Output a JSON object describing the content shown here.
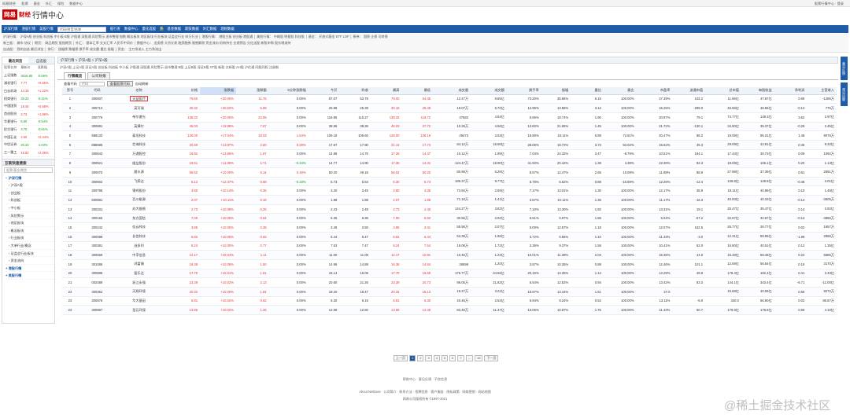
{
  "topbar": [
    "网易财经",
    "股票",
    "基金",
    "外汇",
    "保险",
    "数据中心"
  ],
  "topbar_right": "股票行情中心 · 登录",
  "logo": {
    "brand": "网易",
    "channel": "财经",
    "title": "行情中心"
  },
  "nav": {
    "items": [
      "沪深行情",
      "港股行情",
      "美股行情"
    ],
    "search_placeholder": "代码/拼音/名称",
    "buttons": [
      "股行查",
      "数据中心",
      "量化选股"
    ],
    "tag": "热",
    "extra": [
      "基金数据",
      "期货数据",
      "外汇数据",
      "理财数据"
    ]
  },
  "menu2": [
    "沪深行情：  沪深A股  创业板  科创板  中小板  B股  沪股通  深股通  风险警示  退市整理  指数  概念板块  地区板块  行业板块  证监会行业  申万行业  │  港股行情：  港股主板  创业板  港股通  │  美股行情：  中概股  明星股  科技股  │  基金：  开放式基金  ETF  LOF  │  债券：  国债  企债  可转债",
    "新三板：  做市  协议  │  期货：  商品期货  股指期货  │  外汇：  基本汇率  交叉汇率  人民币中间价  │  数据中心：  龙虎榜  大宗交易  融资融券  限售解禁  资金流向  机构持仓  业绩预告  分红送配  新股申购  股东增减持",
    "自选股：  我的自选  最近浏览  │  排行：  涨幅榜  跌幅榜  换手率  成交额  量比  振幅  │  资金：  主力净流入  主力净流出"
  ],
  "left": {
    "tabs": [
      "最近浏览",
      "自选股"
    ],
    "headers": [
      "股票名称",
      "最新价",
      "涨跌幅"
    ],
    "rows": [
      {
        "name": "上证指数",
        "price": "3016.85",
        "chg": "-0.56%"
      },
      {
        "name": "浦发银行",
        "price": "7.77",
        "chg": "+0.65%"
      },
      {
        "name": "白云机场",
        "price": "14.15",
        "chg": "+1.22%"
      },
      {
        "name": "招商银行",
        "price": "33.23",
        "chg": "-0.21%"
      },
      {
        "name": "中国国贸",
        "price": "18.45",
        "chg": "+0.68%"
      },
      {
        "name": "首创股份",
        "price": "2.73",
        "chg": "+1.86%"
      },
      {
        "name": "华夏银行",
        "price": "5.50",
        "chg": "-0.54%"
      },
      {
        "name": "民生银行",
        "price": "3.70",
        "chg": "-0.81%"
      },
      {
        "name": "中国石化",
        "price": "4.60",
        "chg": "+0.44%"
      },
      {
        "name": "中信证券",
        "price": "20.23",
        "chg": "-1.03%"
      },
      {
        "name": "三一重工",
        "price": "15.82",
        "chg": "+2.06%"
      }
    ],
    "section": "互联快速搜索",
    "search_placeholder": "股票/基金/期货",
    "tree": [
      "沪深行情",
      "沪深A股",
      "创业板",
      "科创板",
      "中小板",
      "风险警示",
      "地区板块",
      "概念板块",
      "行业板块",
      "大单行业/概念",
      "证监会行业板块",
      "资金流向"
    ],
    "tree_foot": [
      "港股行情",
      "美股行情"
    ]
  },
  "main": {
    "breadcrumb": "沪深行情  >  沪深A股  >  沪深A股",
    "subnav": "沪深A股  上证A股  深证A股  创业板  科创板  中小板  沪股通  深股通  风险警示  退市整理  B股  上证B股  深证B股  ST股  新股  次新股  AH股  沪伦通  同股同权  注册制",
    "tabs": [
      "行情概览",
      "公司财报"
    ],
    "filter": {
      "label": "查看代码",
      "placeholder": "代码",
      "button": "查看股票代码",
      "link": "自动刷新"
    },
    "headers": [
      "序号",
      "代码",
      "名称",
      "价格",
      "涨跌幅",
      "涨跌额",
      "5分钟涨跌幅",
      "今开",
      "昨收",
      "最高",
      "最低",
      "成交量",
      "成交额",
      "换手率",
      "振幅",
      "量比",
      "委比",
      "市盈率",
      "流通市值",
      "总市值",
      "每股收益",
      "净利润",
      "主营收入"
    ],
    "rows": [
      [
        "1",
        "300937",
        "天益医疗",
        "79.60",
        "+20.00%",
        "11.76",
        "0.00%",
        "57.07",
        "53.79",
        "79.00",
        "64.45",
        "12.47万",
        "9.85亿",
        "73.20%",
        "35.86%",
        "6.15",
        "100.00%",
        "27.39%",
        "102.2",
        "11.96亿",
        "47.87亿",
        "0.69",
        "-1286万"
      ],
      [
        "2",
        "300713",
        "英可瑞",
        "30.32",
        "+20.02%",
        "5.08",
        "0.00%",
        "25.88",
        "25.39",
        "30.16",
        "25.49",
        "19.07万",
        "5.70亿",
        "12.95%",
        "13.58%",
        "3.12",
        "100.00%",
        "15.25%",
        "-299.0",
        "46.56亿",
        "46.56亿",
        "-0.13",
        "775万"
      ],
      [
        "3",
        "300776",
        "帝尔激光",
        "138.32",
        "+20.00%",
        "23.05",
        "0.00%",
        "116.95",
        "115.27",
        "138.32",
        "116.72",
        "37582",
        "4.84亿",
        "6.65%",
        "18.74%",
        "1.90",
        "100.00%",
        "20.97%",
        "79.1",
        "74.77亿",
        "149.3亿",
        "3.62",
        "2.97亿"
      ],
      [
        "4",
        "300681",
        "英搏尔",
        "46.03",
        "+19.99%",
        "7.67",
        "0.00%",
        "38.96",
        "38.36",
        "46.03",
        "37.72",
        "10.26万",
        "4.56亿",
        "13.60%",
        "21.65%",
        "1.45",
        "100.00%",
        "21.72%",
        "-130.1",
        "34.90亿",
        "35.37亿",
        "-0.26",
        "2.45亿"
      ],
      [
        "5",
        "688133",
        "泰坦科技",
        "128.00",
        "+17.04%",
        "18.03",
        "1.84%",
        "109.18",
        "109.60",
        "128.00",
        "108.19",
        "29473",
        "3.53亿",
        "18.90%",
        "18.11%",
        "5.89",
        "72.81%",
        "20.47%",
        "86.2",
        "19.09亿",
        "95.31亿",
        "1.48",
        "9076万"
      ],
      [
        "6",
        "688595",
        "芯海科技",
        "20.40",
        "+13.97%",
        "2.60",
        "0.28%",
        "17.67",
        "17.90",
        "21.12",
        "17.73",
        "84.12万",
        "16.66亿",
        "28.06%",
        "19.72%",
        "3.73",
        "92.02%",
        "15.52%",
        "45.3",
        "29.09亿",
        "42.81亿",
        "0.45",
        "9.32亿"
      ],
      [
        "7",
        "300643",
        "万通智控",
        "16.92",
        "+13.86%",
        "1.97",
        "0.00%",
        "14.88",
        "14.76",
        "17.26",
        "14.47",
        "10.12万",
        "1.99亿",
        "7.04%",
        "24.32%",
        "3.47",
        "-8.79%",
        "10.51%",
        "184.1",
        "17.44亿",
        "30.73亿",
        "0.09",
        "1092万"
      ],
      [
        "8",
        "300621",
        "维业股份",
        "18.51",
        "+11.09%",
        "1.71",
        "-0.34%",
        "14.77",
        "14.90",
        "17.35",
        "14.31",
        "124.47万",
        "19.90亿",
        "41.50%",
        "20.42%",
        "1.38",
        "4.38%",
        "22.39%",
        "82.3",
        "19.09亿",
        "106.1亿",
        "0.20",
        "1.13亿"
      ],
      [
        "9",
        "300070",
        "碧水源",
        "56.52",
        "+10.00%",
        "5.14",
        "0.49%",
        "50.20",
        "49.18",
        "56.52",
        "50.20",
        "80.98万",
        "5.26亿",
        "8.67%",
        "12.47%",
        "2.65",
        "10.08%",
        "11.89%",
        "88.9",
        "27.98亿",
        "37.39亿",
        "0.61",
        "2691万"
      ],
      [
        "10",
        "300602",
        "飞荣达",
        "6.12",
        "+12.47%",
        "0.68",
        "-0.18%",
        "5.73",
        "5.64",
        "6.30",
        "5.73",
        "186.37万",
        "9.77亿",
        "6.78%",
        "6.62%",
        "0.88",
        "-16.89%",
        "12.29%",
        "-12.4",
        "128.8亿",
        "128.8亿",
        "-0.48",
        "2.01亿"
      ],
      [
        "11",
        "300798",
        "锦鸡股份",
        "3.80",
        "+10.14%",
        "0.35",
        "0.00%",
        "3.40",
        "3.45",
        "3.80",
        "3.35",
        "73.94万",
        "2.69亿",
        "7.17%",
        "13.01%",
        "1.30",
        "100.00%",
        "12.17%",
        "36.9",
        "18.11亿",
        "40.98亿",
        "0.10",
        "1.46亿"
      ],
      [
        "12",
        "600681",
        "百川能源",
        "2.07",
        "+10.11%",
        "0.19",
        "0.00%",
        "1.88",
        "1.88",
        "2.07",
        "1.88",
        "71.18万",
        "1.41亿",
        "3.87%",
        "10.11%",
        "1.36",
        "100.00%",
        "11.17%",
        "-16.3",
        "40.93亿",
        "40.33亿",
        "-0.14",
        "-3605万"
      ],
      [
        "13",
        "300331",
        "苏大维格",
        "2.73",
        "+10.08%",
        "0.25",
        "0.00%",
        "2.43",
        "2.48",
        "2.73",
        "2.40",
        "144.27万",
        "3.82亿",
        "7.10%",
        "13.30%",
        "1.92",
        "100.00%",
        "13.31%",
        "19.1",
        "25.47亿",
        "35.47亿",
        "0.14",
        "3.92亿"
      ],
      [
        "14",
        "300166",
        "东方国信",
        "7.00",
        "+10.06%",
        "0.64",
        "0.00%",
        "6.35",
        "6.36",
        "7.00",
        "6.62",
        "30.55万",
        "2.02亿",
        "6.51%",
        "5.97%",
        "1.55",
        "100.00%",
        "5.04%",
        "-57.2",
        "32.67亿",
        "32.67亿",
        "-0.12",
        "-4856万"
      ],
      [
        "15",
        "300242",
        "佳云科技",
        "3.85",
        "+10.00%",
        "0.35",
        "0.00%",
        "3.48",
        "3.50",
        "3.85",
        "3.41",
        "55.96万",
        "2.07亿",
        "5.00%",
        "12.57%",
        "1.18",
        "100.00%",
        "12.07%",
        "162.5",
        "26.77亿",
        "26.77亿",
        "0.02",
        "1657万"
      ],
      [
        "16",
        "300088",
        "长信科技",
        "6.82",
        "+10.00%",
        "0.62",
        "0.00%",
        "6.44",
        "5.47",
        "6.82",
        "6.44",
        "52.39万",
        "1.96亿",
        "3.72%",
        "6.55%",
        "1.10",
        "100.00%",
        "11.33%",
        "-3.0",
        "12.31亿",
        "88.99亿",
        "-1.99",
        "2858万"
      ],
      [
        "17",
        "300381",
        "溢多利",
        "8.24",
        "+10.00%",
        "0.77",
        "0.00%",
        "7.53",
        "7.47",
        "8.24",
        "7.54",
        "19.08万",
        "1.72亿",
        "3.36%",
        "9.37%",
        "1.58",
        "100.00%",
        "10.41%",
        "62.0",
        "16.80亿",
        "40.51亿",
        "0.12",
        "1.35亿"
      ],
      [
        "18",
        "300659",
        "中孚信息",
        "12.17",
        "+10.04%",
        "1.11",
        "0.00%",
        "11.00",
        "11.06",
        "12.17",
        "10.91",
        "10.46万",
        "1.23亿",
        "10.01%",
        "11.39%",
        "2.04",
        "100.00%",
        "15.36%",
        "44.6",
        "15.48亿",
        "68.48亿",
        "0.22",
        "6686万"
      ],
      [
        "19",
        "301086",
        "鸿富瀚",
        "16.38",
        "+10.06%",
        "1.50",
        "0.00%",
        "14.96",
        "14.88",
        "16.38",
        "14.84",
        "26599",
        "1.20亿",
        "3.87%",
        "10.35%",
        "0.88",
        "100.00%",
        "12.46%",
        "101.1",
        "12.69亿",
        "56.64亿",
        "0.16",
        "3170万"
      ],
      [
        "20",
        "300696",
        "爱乐达",
        "17.70",
        "+10.01%",
        "1.61",
        "0.00%",
        "16.14",
        "16.09",
        "17.70",
        "15.69",
        "176.77万",
        "34.56亿",
        "20.16%",
        "13.35%",
        "1.12",
        "100.00%",
        "13.29%",
        "49.8",
        "178.4亿",
        "182.4亿",
        "0.41",
        "2.33亿"
      ],
      [
        "21",
        "002489",
        "浙江永强",
        "23.39",
        "+10.02%",
        "2.13",
        "0.00%",
        "20.60",
        "21.26",
        "23.39",
        "20.73",
        "96.05万",
        "21.82亿",
        "6.54%",
        "12.52%",
        "0.94",
        "100.00%",
        "13.42%",
        "83.3",
        "144.1亿",
        "343.4亿",
        "-6.71",
        "-11.00亿"
      ],
      [
        "22",
        "300362",
        "天翔环境",
        "20.32",
        "+10.00%",
        "1.84",
        "0.00%",
        "18.20",
        "18.47",
        "20.32",
        "18.13",
        "16.27万",
        "3.22亿",
        "18.97%",
        "13.16%",
        "1.61",
        "100.00%",
        "37.0",
        "",
        "16.69亿",
        "40.06亿",
        "0.56",
        "9272万"
      ],
      [
        "23",
        "300676",
        "华大基因",
        "6.81",
        "+10.02%",
        "0.62",
        "0.00%",
        "6.30",
        "6.19",
        "6.81",
        "6.30",
        "40.45万",
        "2.53亿",
        "6.94%",
        "8.24%",
        "0.52",
        "100.00%",
        "13.11%",
        "-5.0",
        "340.0",
        "66.90亿",
        "0.02",
        "86.87万"
      ],
      [
        "24",
        "300867",
        "圣元环保",
        "13.86",
        "+10.02%",
        "1.26",
        "0.00%",
        "12.58",
        "12.60",
        "13.86",
        "12.49",
        "83.49万",
        "11.37亿",
        "10.06%",
        "10.87%",
        "1.75",
        "100.00%",
        "11.43%",
        "50.7",
        "178.8亿",
        "178.8亿",
        "0.59",
        "4.10亿"
      ]
    ],
    "highlight_name": "天益医疗"
  },
  "pager": [
    "上一页",
    "1",
    "2",
    "3",
    "4",
    "5",
    "6",
    "7",
    "...",
    "15",
    "下一页"
  ],
  "footer": [
    "帮助中心 · 意见反馈 · 不良信息",
    "About NetEase · 公司简介 · 联系方法 · 招聘信息 · 客户服务 · 隐私政策 · 网络营销 · 网站地图",
    "网易公司版权所有 ©1997-2021"
  ],
  "side": [
    "意见反馈",
    "常见问题"
  ],
  "watermark": "@稀土掘金技术社区"
}
